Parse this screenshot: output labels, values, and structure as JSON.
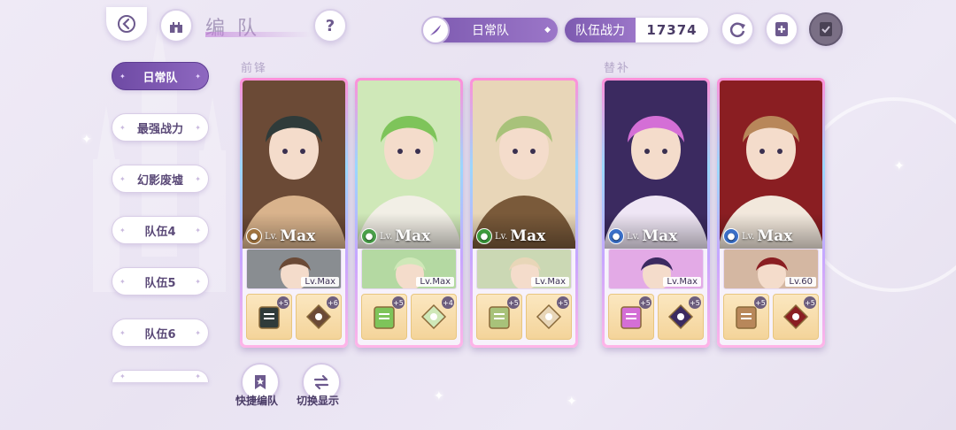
{
  "header": {
    "title": "编队",
    "team_selector": "日常队",
    "power_label": "队伍战力",
    "power_value": "17374"
  },
  "sidebar": {
    "items": [
      {
        "label": "日常队",
        "active": true
      },
      {
        "label": "最强战力",
        "active": false
      },
      {
        "label": "幻影废墟",
        "active": false
      },
      {
        "label": "队伍4",
        "active": false
      },
      {
        "label": "队伍5",
        "active": false
      },
      {
        "label": "队伍6",
        "active": false
      }
    ]
  },
  "sections": {
    "front": "前锋",
    "sub": "替补"
  },
  "cards": [
    {
      "lv_prefix": "Lv.",
      "level": "Max",
      "element_color": "#a0743f",
      "sub_level": "Lv.Max",
      "items": [
        {
          "badge": "+5"
        },
        {
          "badge": "+6"
        }
      ],
      "palette": [
        "#6b4a36",
        "#2f3b3a",
        "#d9b38c"
      ]
    },
    {
      "lv_prefix": "Lv.",
      "level": "Max",
      "element_color": "#4aa04a",
      "sub_level": "Lv.Max",
      "items": [
        {
          "badge": "+5"
        },
        {
          "badge": "+4"
        }
      ],
      "palette": [
        "#cfe8b8",
        "#7ec45a",
        "#f2efe6"
      ]
    },
    {
      "lv_prefix": "Lv.",
      "level": "Max",
      "element_color": "#3c9a3c",
      "sub_level": "Lv.Max",
      "items": [
        {
          "badge": "+5"
        },
        {
          "badge": "+5"
        }
      ],
      "palette": [
        "#e8d6b8",
        "#a8c27a",
        "#7a5a3a"
      ]
    },
    {
      "lv_prefix": "Lv.",
      "level": "Max",
      "element_color": "#3a6fc8",
      "sub_level": "Lv.Max",
      "items": [
        {
          "badge": "+5"
        },
        {
          "badge": "+5"
        }
      ],
      "palette": [
        "#3b2a60",
        "#d46fd6",
        "#efe6f5"
      ]
    },
    {
      "lv_prefix": "Lv.",
      "level": "Max",
      "element_color": "#3a6fc8",
      "sub_level": "Lv.60",
      "items": [
        {
          "badge": "+5"
        },
        {
          "badge": "+5"
        }
      ],
      "palette": [
        "#8a1e22",
        "#b8875a",
        "#f2e8dc"
      ]
    }
  ],
  "bottom": {
    "quick_label": "快捷编队",
    "switch_label": "切换显示"
  },
  "colors": {
    "accent": "#7d5ab0",
    "background": "#ece7f4"
  }
}
